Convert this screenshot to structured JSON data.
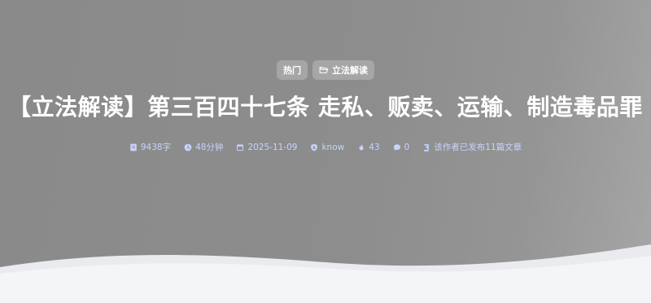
{
  "tags": [
    {
      "label": "热门",
      "icon": ""
    },
    {
      "label": "立法解读",
      "icon": "folder-open-icon"
    }
  ],
  "title": "【立法解读】第三百四十七条 走私、贩卖、运输、制造毒品罪",
  "meta": {
    "word_count": "9438字",
    "read_time": "48分钟",
    "date": "2025-11-09",
    "author": "know",
    "views": "43",
    "comments": "0",
    "author_posts": "该作者已发布11篇文章"
  },
  "colors": {
    "hero_background": "#8d8d8d",
    "page_background": "#f4f5f7",
    "meta_text": "#c7d3ff",
    "title_text": "#ffffff"
  }
}
